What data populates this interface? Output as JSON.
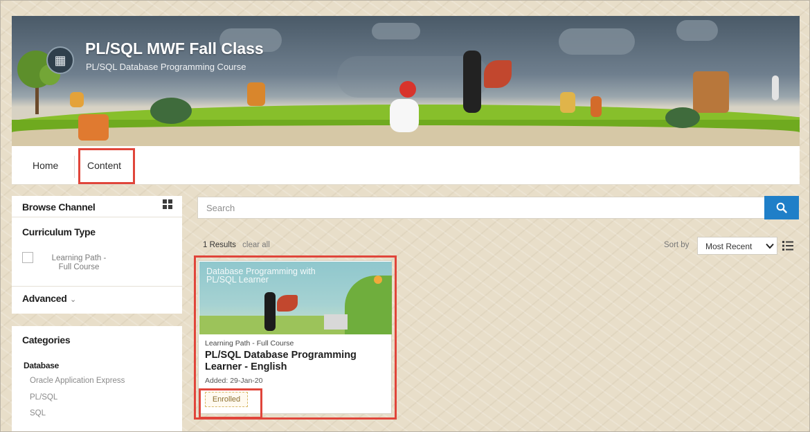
{
  "banner": {
    "title": "PL/SQL MWF Fall Class",
    "subtitle": "PL/SQL Database Programming Course",
    "icon": "classroom-icon"
  },
  "nav": {
    "tabs": [
      {
        "label": "Home"
      },
      {
        "label": "Content"
      }
    ]
  },
  "sidebar": {
    "browse_channel": "Browse Channel",
    "curriculum_type": "Curriculum Type",
    "curriculum_option": "Learning Path - Full Course",
    "advanced": "Advanced",
    "categories_title": "Categories",
    "categories": {
      "group": "Database",
      "items": [
        "Oracle Application Express",
        "PL/SQL",
        "SQL"
      ]
    }
  },
  "search": {
    "placeholder": "Search"
  },
  "results": {
    "count_label": "1 Results",
    "clear_all": "clear all",
    "sort_by": "Sort by",
    "sort_value": "Most Recent"
  },
  "card": {
    "image_title": "Database Programming with PL/SQL Learner",
    "type": "Learning Path - Full Course",
    "title": "PL/SQL Database Programming Learner - English",
    "added": "Added: 29-Jan-20",
    "status": "Enrolled"
  },
  "colors": {
    "accent": "#1f7fc8",
    "highlight": "#e0453a",
    "hill": "#87bf2b"
  }
}
